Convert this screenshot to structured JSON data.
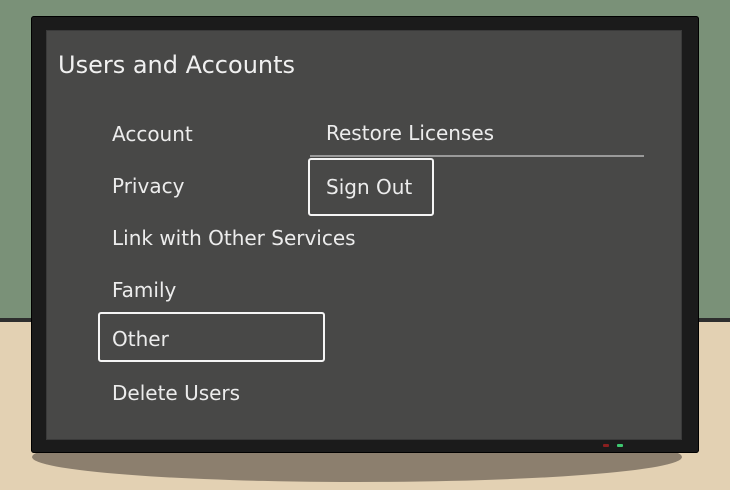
{
  "colors": {
    "wall": "#7a9178",
    "floor": "#e3d1b3",
    "shadow": "#8c7f6e",
    "tv_bezel": "#1b1b1b",
    "screen_bg": "#484847",
    "led_green": "#3ec870",
    "led_red": "#8a1f1f"
  },
  "screen": {
    "title": "Users and Accounts",
    "menu": [
      {
        "label": "Account",
        "selected": false
      },
      {
        "label": "Privacy",
        "selected": false
      },
      {
        "label": "Link with Other Services",
        "selected": false
      },
      {
        "label": "Family",
        "selected": false
      },
      {
        "label": "Other",
        "selected": true
      },
      {
        "label": "Delete Users",
        "selected": false
      }
    ],
    "submenu": [
      {
        "label": "Restore Licenses",
        "selected": false
      },
      {
        "label": "Sign Out",
        "selected": true
      }
    ]
  }
}
